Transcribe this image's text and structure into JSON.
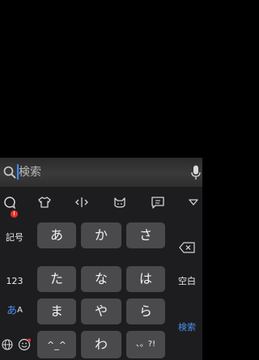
{
  "search": {
    "placeholder": "検索"
  },
  "toolbar": {
    "badge_count": "!",
    "icons": [
      "speech-bubble-icon",
      "shirt-icon",
      "cursor-move-icon",
      "cat-face-icon",
      "message-icon",
      "collapse-keyboard-icon"
    ]
  },
  "keyboard": {
    "left_keys": [
      "記号",
      "123",
      "あ",
      "A"
    ],
    "rows": [
      [
        "あ",
        "か",
        "さ"
      ],
      [
        "た",
        "な",
        "は"
      ],
      [
        "ま",
        "や",
        "ら"
      ],
      [
        "^_^",
        "わ",
        "、。?!"
      ]
    ],
    "right_keys": {
      "space": "空白",
      "search": "検索"
    }
  },
  "colors": {
    "accent": "#4a90f0",
    "badge": "#e8332c",
    "key_bg": "#4a4a4d",
    "keyboard_bg": "#1d1d1f"
  }
}
